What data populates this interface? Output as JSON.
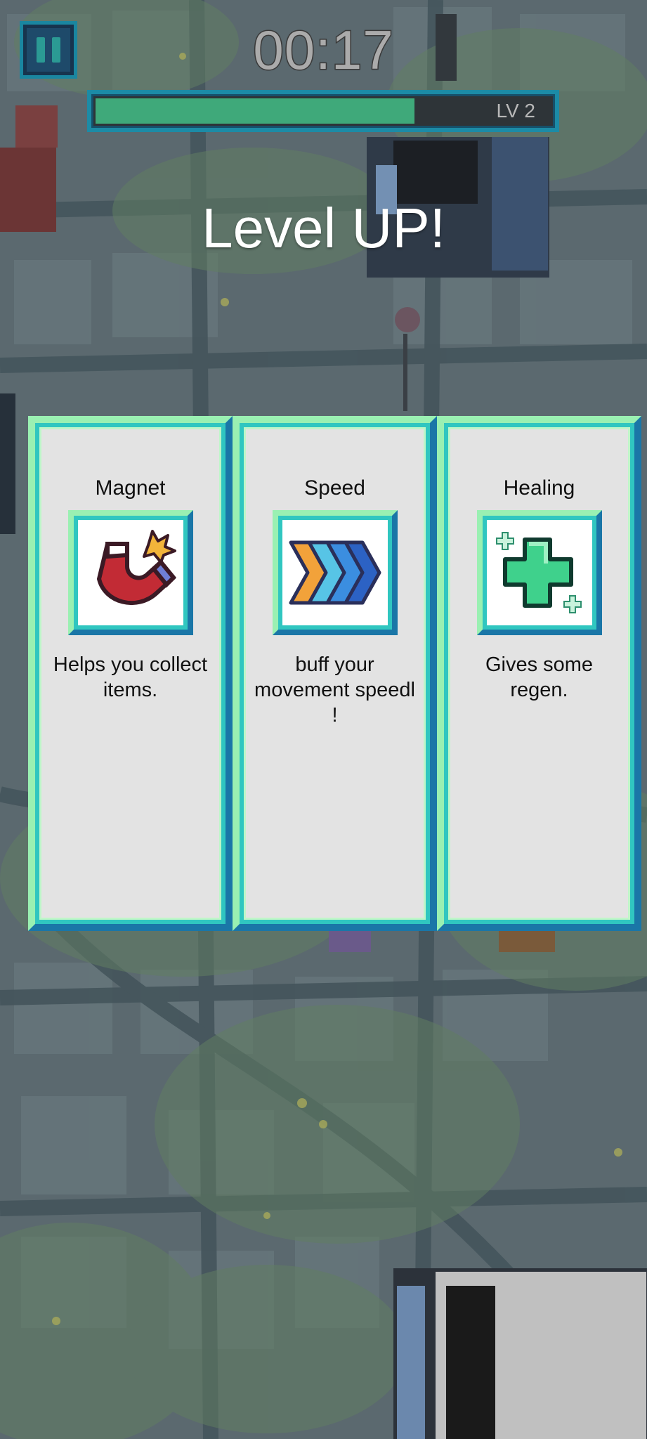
{
  "hud": {
    "timer": "00:17",
    "level_label": "LV 2",
    "xp_progress": 0.7,
    "xp_color": "#3fa97a"
  },
  "banner": {
    "title": "Level UP!"
  },
  "cards": [
    {
      "name": "Magnet",
      "description": "Helps you collect items.",
      "icon": "magnet-icon"
    },
    {
      "name": "Speed",
      "description": "buff your movement speedl !",
      "icon": "speed-chevrons-icon"
    },
    {
      "name": "Healing",
      "description": "Gives some regen.",
      "icon": "healing-cross-icon"
    }
  ],
  "colors": {
    "frame_light": "#9af0b2",
    "frame_dark": "#1a76a7",
    "card_bg": "#e3e3e3"
  }
}
